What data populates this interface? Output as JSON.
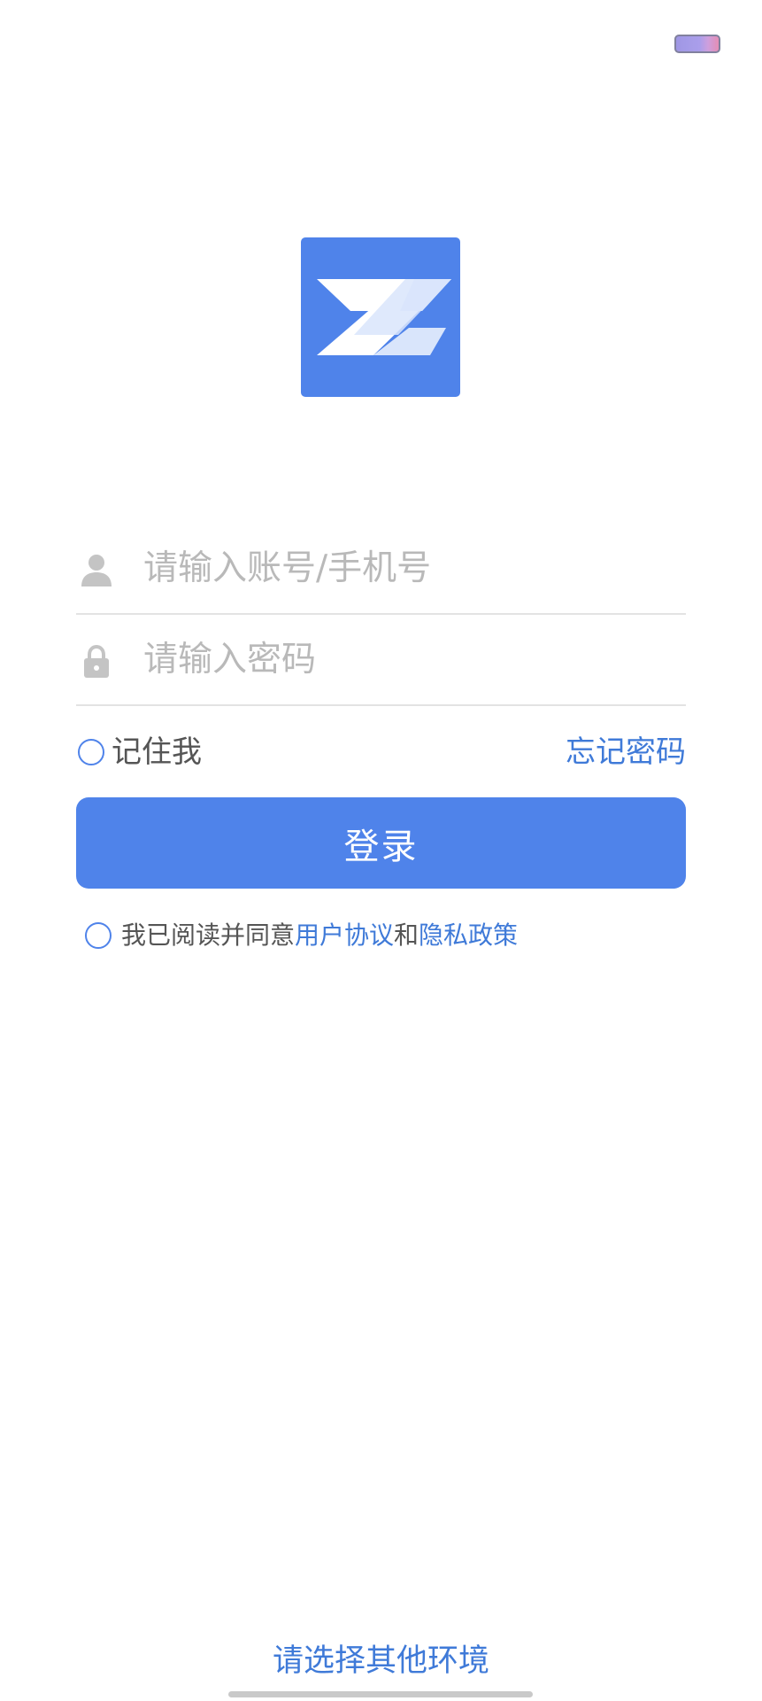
{
  "colors": {
    "accent": "#4f83ea",
    "link": "#3f7ad8",
    "placeholder": "#b9b9b9",
    "divider": "#e3e3e3"
  },
  "status_bar": {
    "battery_icon": "battery-icon"
  },
  "logo": {
    "icon": "z-logo-icon"
  },
  "login_form": {
    "username": {
      "icon": "user-icon",
      "value": "",
      "placeholder": "请输入账号/手机号"
    },
    "password": {
      "icon": "lock-icon",
      "value": "",
      "placeholder": "请输入密码"
    },
    "remember_me": {
      "label": "记住我",
      "checked": false
    },
    "forgot_password_label": "忘记密码",
    "login_button_label": "登录"
  },
  "agreement": {
    "checked": false,
    "prefix": "我已阅读并同意",
    "user_agreement": "用户协议",
    "conjunction": "和",
    "privacy_policy": "隐私政策"
  },
  "footer": {
    "choose_environment_label": "请选择其他环境"
  }
}
